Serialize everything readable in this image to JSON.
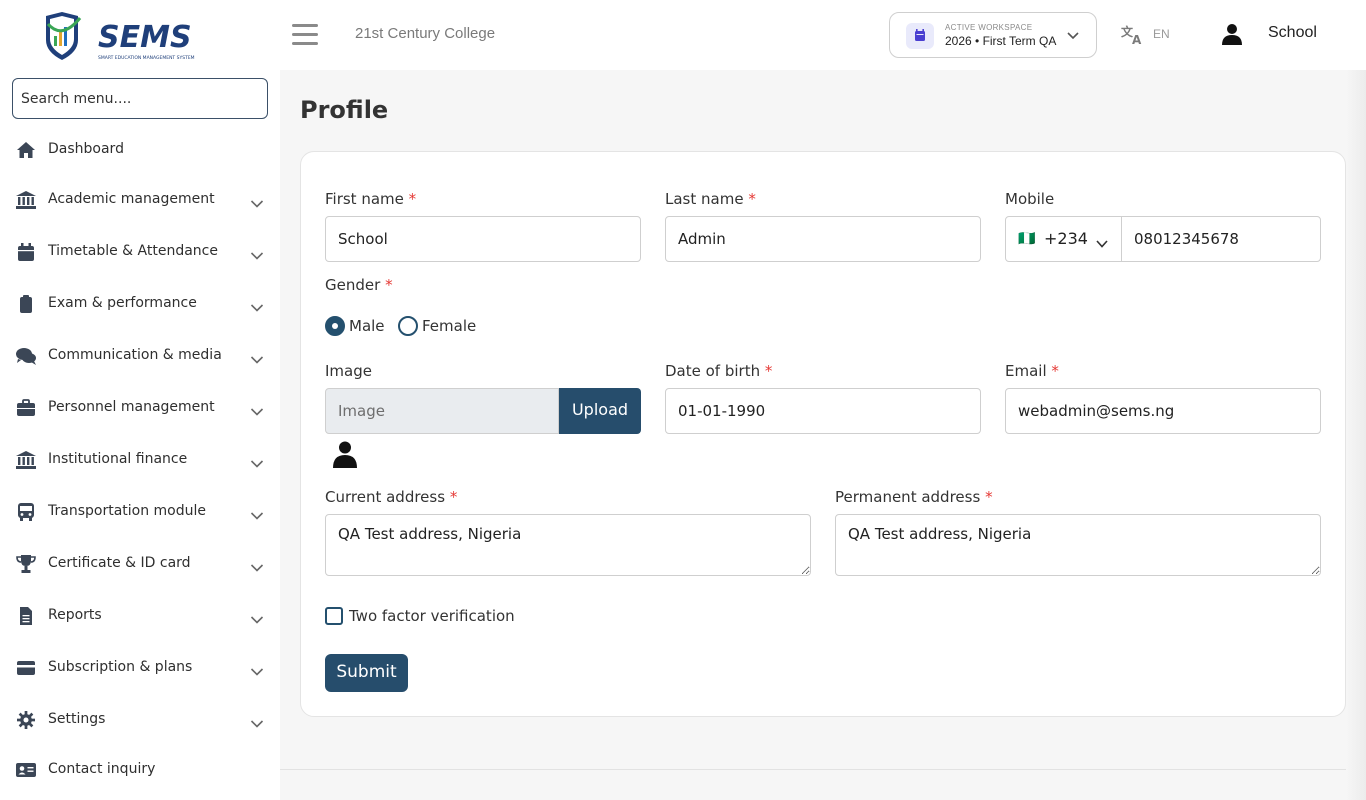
{
  "brand": {
    "name": "SEMS",
    "tagline": "SMART EDUCATION MANAGEMENT SYSTEM"
  },
  "header": {
    "college": "21st Century College",
    "workspace_label": "ACTIVE WORKSPACE",
    "workspace_value": "2026 • First Term QA",
    "language": "EN",
    "user_name": "School"
  },
  "sidebar": {
    "search_placeholder": "Search menu....",
    "items": [
      {
        "label": "Dashboard",
        "icon": "home-icon",
        "expandable": false
      },
      {
        "label": "Academic management",
        "icon": "bank-icon",
        "expandable": true
      },
      {
        "label": "Timetable & Attendance",
        "icon": "calendar-icon",
        "expandable": true
      },
      {
        "label": "Exam & performance",
        "icon": "clipboard-icon",
        "expandable": true
      },
      {
        "label": "Communication & media",
        "icon": "chat-icon",
        "expandable": true
      },
      {
        "label": "Personnel management",
        "icon": "briefcase-icon",
        "expandable": true
      },
      {
        "label": "Institutional finance",
        "icon": "bank-icon",
        "expandable": true
      },
      {
        "label": "Transportation module",
        "icon": "bus-icon",
        "expandable": true
      },
      {
        "label": "Certificate & ID card",
        "icon": "trophy-icon",
        "expandable": true
      },
      {
        "label": "Reports",
        "icon": "file-icon",
        "expandable": true
      },
      {
        "label": "Subscription & plans",
        "icon": "card-icon",
        "expandable": true
      },
      {
        "label": "Settings",
        "icon": "gear-icon",
        "expandable": true
      },
      {
        "label": "Contact inquiry",
        "icon": "contact-icon",
        "expandable": false
      }
    ]
  },
  "page": {
    "title": "Profile",
    "form": {
      "first_name": {
        "label": "First name",
        "required": "*",
        "value": "School"
      },
      "last_name": {
        "label": "Last name",
        "required": "*",
        "value": "Admin"
      },
      "mobile": {
        "label": "Mobile",
        "country_code": "+234",
        "flag": "🇳🇬",
        "value": "08012345678"
      },
      "gender": {
        "label": "Gender",
        "required": "*",
        "options": [
          "Male",
          "Female"
        ],
        "selected": "Male"
      },
      "image": {
        "label": "Image",
        "placeholder": "Image",
        "button": "Upload"
      },
      "dob": {
        "label": "Date of birth",
        "required": "*",
        "value": "01-01-1990"
      },
      "email": {
        "label": "Email",
        "required": "*",
        "value": "webadmin@sems.ng"
      },
      "current_address": {
        "label": "Current address",
        "required": "*",
        "value": "QA Test address, Nigeria"
      },
      "permanent_address": {
        "label": "Permanent address",
        "required": "*",
        "value": "QA Test address, Nigeria"
      },
      "two_factor": {
        "label": "Two factor verification",
        "checked": false
      },
      "submit": "Submit"
    }
  },
  "colors": {
    "primary": "#264d6c",
    "required": "#e53935",
    "logo_blue": "#1f3f7a",
    "logo_green": "#3aa655"
  }
}
